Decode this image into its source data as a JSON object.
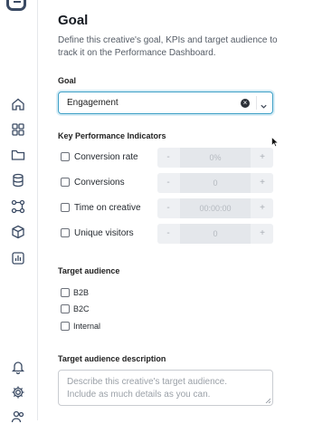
{
  "page": {
    "title": "Goal",
    "description": "Define this creative's goal, KPIs and target audience to track it on the Performance Dashboard."
  },
  "goal": {
    "label": "Goal",
    "value": "Engagement"
  },
  "kpis": {
    "label": "Key Performance Indicators",
    "items": [
      {
        "label": "Conversion rate",
        "value": "0%"
      },
      {
        "label": "Conversions",
        "value": "0"
      },
      {
        "label": "Time on creative",
        "value": "00:00:00"
      },
      {
        "label": "Unique visitors",
        "value": "0"
      }
    ],
    "minus": "-",
    "plus": "+"
  },
  "audience": {
    "label": "Target audience",
    "options": [
      "B2B",
      "B2C",
      "Internal"
    ]
  },
  "audience_description": {
    "label": "Target audience description",
    "placeholder_line1": "Describe this creative's target audience.",
    "placeholder_line2": "Include as much details as you can."
  },
  "icons": {
    "sidebar": [
      "home-icon",
      "apps-grid-icon",
      "folder-icon",
      "database-icon",
      "workflow-icon",
      "cube-icon",
      "chart-icon",
      "bell-icon",
      "gear-icon",
      "users-icon"
    ],
    "close": "close-circle-icon",
    "chevron": "chevron-down-icon"
  },
  "colors": {
    "accent": "#3c9fc6",
    "sidebar_icon": "#3a4a63"
  }
}
